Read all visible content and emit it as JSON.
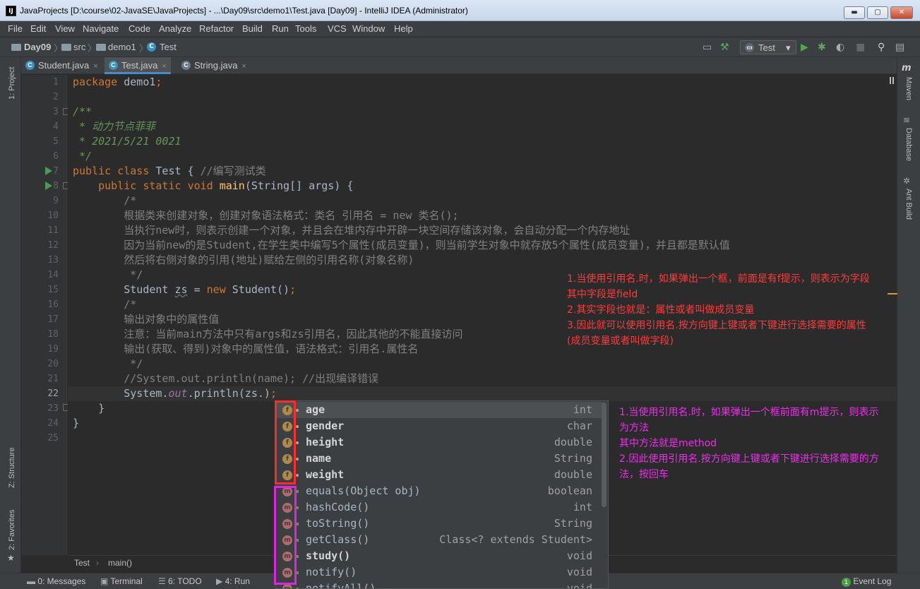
{
  "window": {
    "title": "JavaProjects [D:\\course\\02-JavaSE\\JavaProjects] - ...\\Day09\\src\\demo1\\Test.java [Day09] - IntelliJ IDEA (Administrator)",
    "app_icon_text": "IJ",
    "btn_minimize": "▬",
    "btn_maximize": "▢",
    "btn_close": "✕"
  },
  "menu": [
    "File",
    "Edit",
    "View",
    "Navigate",
    "Code",
    "Analyze",
    "Refactor",
    "Build",
    "Run",
    "Tools",
    "VCS",
    "Window",
    "Help"
  ],
  "nav": {
    "crumbs": [
      "Day09",
      "src",
      "demo1",
      "Test"
    ],
    "run_config": "Test",
    "dropdown_arrow": "▾"
  },
  "tabs": [
    {
      "label": "Student.java",
      "active": false
    },
    {
      "label": "Test.java",
      "active": true
    },
    {
      "label": "String.java",
      "active": false
    }
  ],
  "tab_close": "×",
  "left_stripe": {
    "project": "1: Project",
    "structure": "Z: Structure",
    "favorites": "2: Favorites"
  },
  "right_stripe": {
    "maven": "Maven",
    "database": "Database",
    "ant": "Ant Build",
    "maven_glyph": "m"
  },
  "editor": {
    "current_line": 22,
    "lines": [
      "package demo1;",
      "",
      "/**",
      " * 动力节点菲菲",
      " * 2021/5/21 0021",
      " */",
      "public class Test { //编写测试类",
      "    public static void main(String[] args) {",
      "        /*",
      "        根据类来创建对象，创建对象语法格式：类名 引用名 = new 类名();",
      "        当执行new时，则表示创建一个对象，并且会在堆内存中开辟一块空间存储该对象，会自动分配一个内存地址",
      "        因为当前new的是Student,在学生类中编写5个属性(成员变量)，则当前学生对象中就存放5个属性(成员变量)，并且都是默认值",
      "        然后将右侧对象的引用(地址)赋给左侧的引用名称(对象名称)",
      "         */",
      "        Student zs = new Student();",
      "        /*",
      "        输出对象中的属性值",
      "        注意：当前main方法中只有args和zs引用名，因此其他的不能直接访问",
      "        输出(获取、得到)对象中的属性值，语法格式：引用名.属性名",
      "         */",
      "        //System.out.println(name); //出现编译错误",
      "        System.out.println(zs.);",
      "    }",
      "}",
      ""
    ]
  },
  "breadcrumbs": [
    "Test",
    "main()"
  ],
  "completion": {
    "fields": [
      {
        "name": "age",
        "type": "int"
      },
      {
        "name": "gender",
        "type": "char"
      },
      {
        "name": "height",
        "type": "double"
      },
      {
        "name": "name",
        "type": "String"
      },
      {
        "name": "weight",
        "type": "double"
      }
    ],
    "methods": [
      {
        "name": "equals(Object obj)",
        "type": "boolean",
        "bold": false
      },
      {
        "name": "hashCode()",
        "type": "int",
        "bold": false
      },
      {
        "name": "toString()",
        "type": "String",
        "bold": false
      },
      {
        "name": "getClass()",
        "type": "Class<? extends Student>",
        "bold": false
      },
      {
        "name": "study()",
        "type": "void",
        "bold": true
      },
      {
        "name": "notify()",
        "type": "void",
        "bold": false
      },
      {
        "name": "notifyAll()",
        "type": "void",
        "bold": false
      }
    ],
    "field_badge": "f",
    "method_badge": "m"
  },
  "annotations": {
    "red": [
      "1.当使用引用名.时，如果弹出一个框，前面是有f提示，则表示为字段",
      "   其中字段是field",
      "2.其实字段也就是：属性或者叫做成员变量",
      "3.因此就可以使用引用名.按方向键上键或者下键进行选择需要的属性",
      "(成员变量或者叫做字段)"
    ],
    "magenta": [
      "1.当使用引用名.时，如果弹出一个框前面有m提示，则表示",
      "为方法",
      "  其中方法就是method",
      "2.因此使用引用名.按方向键上键或者下键进行选择需要的方",
      "法，按回车"
    ]
  },
  "bottom": {
    "messages": "0: Messages",
    "terminal": "Terminal",
    "todo": "6: TODO",
    "run": "4: Run",
    "event_log": "Event Log",
    "event_count": "1"
  },
  "colors": {
    "keyword": "#cc7832",
    "comment": "#808080",
    "doc": "#629755",
    "annotation_red": "#ff3b3b",
    "annotation_magenta": "#f02cf0"
  }
}
